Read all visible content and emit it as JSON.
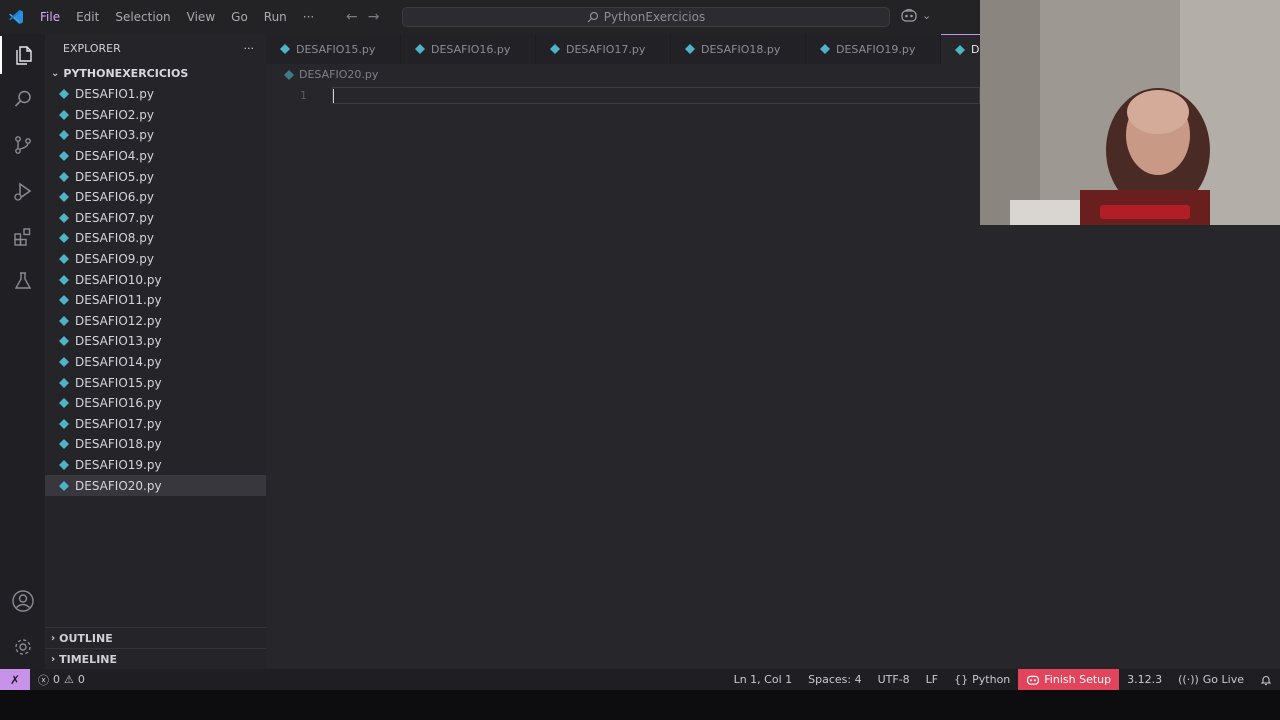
{
  "menu": [
    "File",
    "Edit",
    "Selection",
    "View",
    "Go",
    "Run",
    "···"
  ],
  "command_center": {
    "label": "PythonExercicios"
  },
  "sidebar": {
    "title": "EXPLORER",
    "more": "···",
    "folder": "PYTHONEXERCICIOS",
    "files": [
      "DESAFIO1.py",
      "DESAFIO2.py",
      "DESAFIO3.py",
      "DESAFIO4.py",
      "DESAFIO5.py",
      "DESAFIO6.py",
      "DESAFIO7.py",
      "DESAFIO8.py",
      "DESAFIO9.py",
      "DESAFIO10.py",
      "DESAFIO11.py",
      "DESAFIO12.py",
      "DESAFIO13.py",
      "DESAFIO14.py",
      "DESAFIO15.py",
      "DESAFIO16.py",
      "DESAFIO17.py",
      "DESAFIO18.py",
      "DESAFIO19.py",
      "DESAFIO20.py"
    ],
    "selected_file": "DESAFIO20.py",
    "outline": "OUTLINE",
    "timeline": "TIMELINE"
  },
  "tabs": [
    "DESAFIO15.py",
    "DESAFIO16.py",
    "DESAFIO17.py",
    "DESAFIO18.py",
    "DESAFIO19.py",
    "D"
  ],
  "active_tab_index": 5,
  "editor": {
    "breadcrumb": "DESAFIO20.py",
    "line_number": "1"
  },
  "statusbar": {
    "errors": "0",
    "warnings": "0",
    "position": "Ln 1, Col 1",
    "spaces": "Spaces: 4",
    "encoding": "UTF-8",
    "eol": "LF",
    "language_brace": "{}",
    "language": "Python",
    "finish_setup": "Finish Setup",
    "version": "3.12.3",
    "go_live": "Go Live"
  },
  "colors": {
    "accent": "#c792ea",
    "python_icon": "#4fb3c7",
    "finish_setup_bg": "#e2455b"
  },
  "icons": [
    "vscode-logo",
    "arrow-left-icon",
    "arrow-right-icon",
    "search-icon",
    "copilot-icon",
    "explorer-icon",
    "search-view-icon",
    "source-control-icon",
    "run-debug-icon",
    "extensions-icon",
    "testing-icon",
    "account-icon",
    "settings-gear-icon",
    "chevron-down-icon",
    "chevron-right-icon",
    "python-file-icon",
    "remote-icon",
    "error-icon",
    "warning-icon",
    "broadcast-icon",
    "bell-icon"
  ]
}
